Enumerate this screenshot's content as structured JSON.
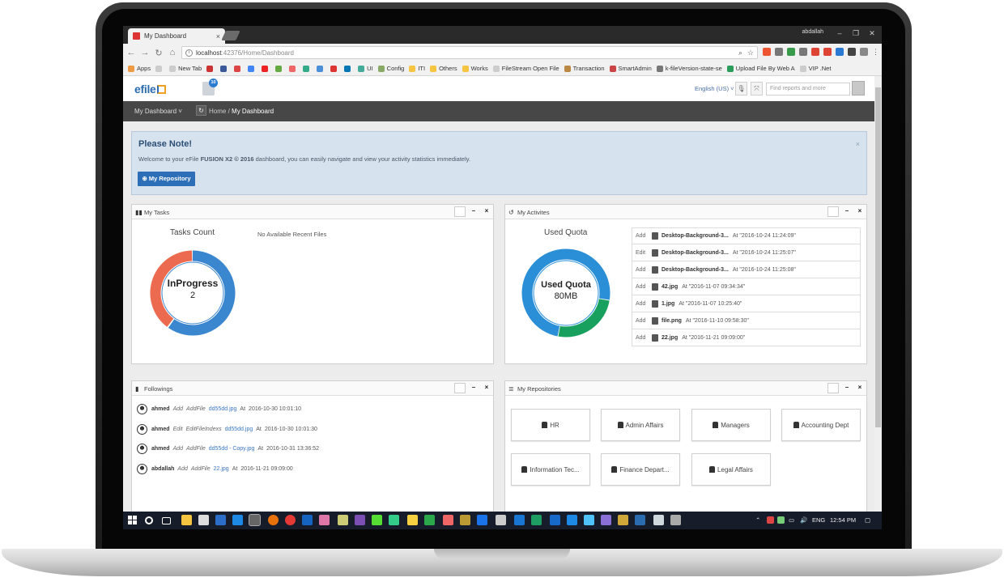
{
  "browser": {
    "tab_title": "My Dashboard",
    "tab_close": "×",
    "window_user": "abdallah",
    "url_host": "localhost",
    "url_path": ":42376/Home/Dashboard",
    "bookmarks": [
      "Apps",
      "New Tab",
      "UI",
      "Config",
      "ITI",
      "Others",
      "Works",
      "FileStream Open File",
      "Transaction",
      "SmartAdmin",
      "k-fileVersion-state-se",
      "Upload File By Web A",
      "VIP .Net"
    ]
  },
  "header": {
    "logo": "efile",
    "notification_count": "10",
    "language": "English (US) ˅",
    "search_placeholder": "Find reports and more"
  },
  "ribbon": {
    "menu": "My Dashboard ˅",
    "crumb_home": "Home /",
    "crumb_current": "My Dashboard"
  },
  "note": {
    "title": "Please Note!",
    "text_pre": "Welcome to your eFile ",
    "text_bold": "FUSION X2 © 2016",
    "text_post": " dashboard, you can easily navigate and view your activity statistics immediately.",
    "button": "My Repository",
    "close": "×"
  },
  "tasks": {
    "title": "My Tasks",
    "chart_title": "Tasks Count",
    "center_label": "InProgress",
    "center_value": "2",
    "recent_files": "No Available Recent Files"
  },
  "activities": {
    "title": "My Activites",
    "chart_title": "Used Quota",
    "center_label": "Used Quota",
    "center_value": "80MB",
    "rows": [
      {
        "verb": "Add",
        "file": "Desktop-Background-3...",
        "at": "At  \"2016-10-24 11:24:09\""
      },
      {
        "verb": "Edit",
        "file": "Desktop-Background-3...",
        "at": "At  \"2016-10-24 11:25:07\""
      },
      {
        "verb": "Add",
        "file": "Desktop-Background-3...",
        "at": "At  \"2016-10-24 11:25:08\""
      },
      {
        "verb": "Add",
        "file": "42.jpg",
        "at": "At  \"2016-11-07 09:34:34\""
      },
      {
        "verb": "Add",
        "file": "1.jpg",
        "at": "At  \"2016-11-07 10:25:40\""
      },
      {
        "verb": "Add",
        "file": "file.png",
        "at": "At  \"2016-11-10 09:58:30\""
      },
      {
        "verb": "Add",
        "file": "22.jpg",
        "at": "At  \"2016-11-21 09:09:00\""
      }
    ]
  },
  "followings": {
    "title": "Followings",
    "rows": [
      {
        "user": "ahmed",
        "action": "Add",
        "type": "AddFile",
        "file": "dd55dd.jpg",
        "at": "At",
        "time": "2016-10-30 10:01:10"
      },
      {
        "user": "ahmed",
        "action": "Edit",
        "type": "EditFileIndexs",
        "file": "dd55dd.jpg",
        "at": "At",
        "time": "2016-10-30 10:01:30"
      },
      {
        "user": "ahmed",
        "action": "Add",
        "type": "AddFile",
        "file": "dd55dd - Copy.jpg",
        "at": "At",
        "time": "2016-10-31 13:36:52"
      },
      {
        "user": "abdallah",
        "action": "Add",
        "type": "AddFile",
        "file": "22.jpg",
        "at": "At",
        "time": "2016-11-21 09:09:00"
      }
    ]
  },
  "repositories": {
    "title": "My Repositories",
    "items": [
      "HR",
      "Admin Affairs",
      "Managers",
      "Accounting Dept",
      "Information Tec...",
      "Finance Depart...",
      "Legal Affairs"
    ]
  },
  "taskbar": {
    "language": "ENG",
    "time": "12:54 PM"
  },
  "colors": {
    "donut_blue": "#3a86cf",
    "donut_orange": "#ec6a4f",
    "donut_green": "#17a05e",
    "quota_blue": "#2b8fd8",
    "primary_button": "#2d6fb6"
  },
  "chart_values": {
    "tasks_inprogress_fraction": 0.6,
    "tasks_other_fraction": 0.4,
    "quota_used_fraction": 0.25
  }
}
